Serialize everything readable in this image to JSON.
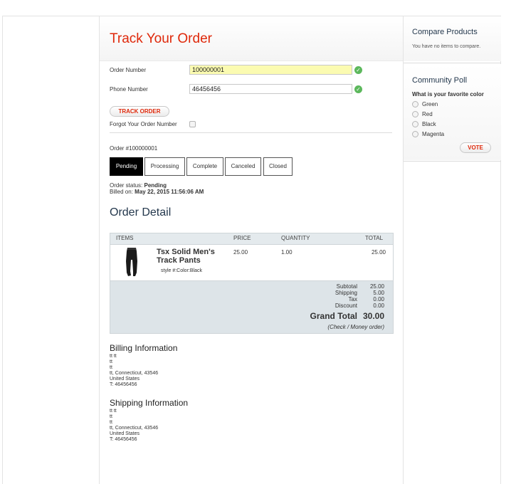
{
  "page": {
    "title": "Track Your Order"
  },
  "form": {
    "order_number_label": "Order Number",
    "order_number_value": "100000001",
    "phone_label": "Phone Number",
    "phone_value": "46456456",
    "track_button": "TRACK ORDER",
    "forgot_label": "Forgot Your Order Number",
    "valid_icon": "check-circle-icon"
  },
  "order": {
    "number_text": "Order #100000001",
    "statuses": [
      "Pending",
      "Processing",
      "Complete",
      "Canceled",
      "Closed"
    ],
    "active_status": "Pending",
    "status_label": "Order status:",
    "status_value": "Pending",
    "billed_label": "Billed on:",
    "billed_value": "May 22, 2015 11:56:06 AM"
  },
  "detail": {
    "heading": "Order Detail",
    "columns": [
      "ITEMS",
      "PRICE",
      "QUANTITY",
      "TOTAL"
    ],
    "item": {
      "name": "Tsx Solid Men's Track Pants",
      "option": "style #:Color:Black",
      "price": "25.00",
      "quantity": "1.00",
      "total": "25.00"
    },
    "totals": {
      "subtotal_label": "Subtotal",
      "subtotal": "25.00",
      "shipping_label": "Shipping",
      "shipping": "5.00",
      "tax_label": "Tax",
      "tax": "0.00",
      "discount_label": "Discount",
      "discount": "0.00",
      "grand_label": "Grand Total",
      "grand": "30.00",
      "payment": "(Check / Money order)"
    }
  },
  "billing": {
    "heading": "Billing Information",
    "lines": "tt tt\ntt\ntt\ntt, Connecticut, 43546\nUnited States\nT: 46456456"
  },
  "shipping": {
    "heading": "Shipping Information",
    "lines": "tt tt\ntt\ntt\ntt, Connecticut, 43546\nUnited States\nT: 46456456"
  },
  "sidebar": {
    "compare_title": "Compare Products",
    "compare_text": "You have no items to compare.",
    "poll_title": "Community Poll",
    "poll_question": "What is your favorite color",
    "poll_options": [
      "Green",
      "Red",
      "Black",
      "Magenta"
    ],
    "vote_button": "VOTE"
  },
  "colors": {
    "accent": "#df280a",
    "heading": "#24384d",
    "valid": "#5cb85c"
  }
}
